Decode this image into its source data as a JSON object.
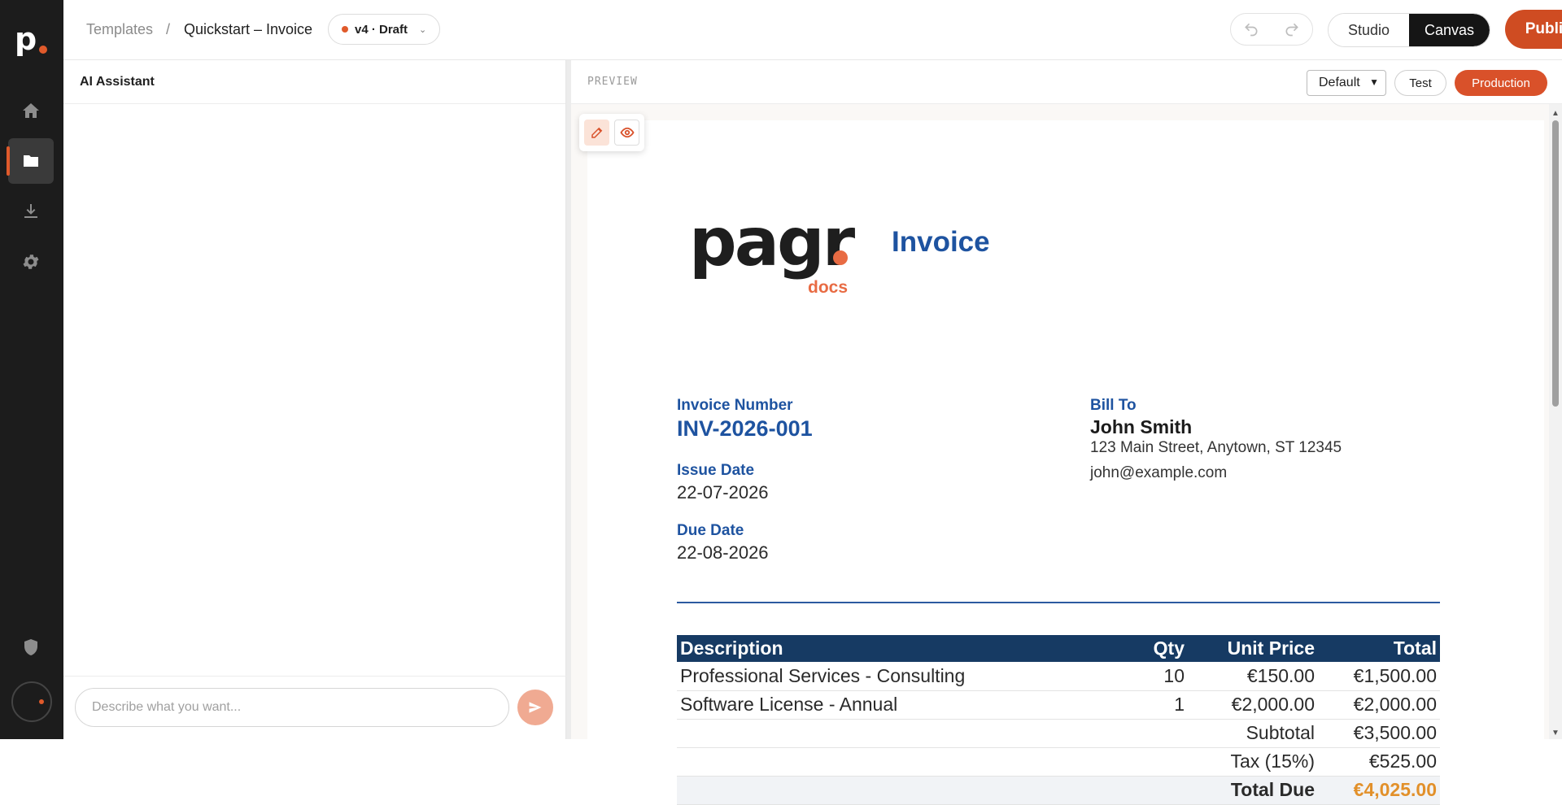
{
  "sidebar": {
    "logo": "p"
  },
  "header": {
    "breadcrumb_root": "Templates",
    "breadcrumb_sep": "/",
    "breadcrumb_current": "Quickstart – Invoice",
    "version": "v4 · Draft",
    "mode_studio": "Studio",
    "mode_canvas": "Canvas",
    "publish_label": "Publish"
  },
  "ai": {
    "title": "AI Assistant",
    "placeholder": "Describe what you want..."
  },
  "preview": {
    "label": "PREVIEW",
    "theme": "Default",
    "env_test": "Test",
    "env_production": "Production"
  },
  "invoice": {
    "logo_word": "pagr",
    "logo_sub": "docs",
    "title": "Invoice",
    "number_label": "Invoice Number",
    "number": "INV-2026-001",
    "issue_label": "Issue Date",
    "issue_date": "22-07-2026",
    "due_label": "Due Date",
    "due_date": "22-08-2026",
    "bill_label": "Bill To",
    "bill_name": "John Smith",
    "bill_address": "123 Main Street, Anytown, ST 12345",
    "bill_email": "john@example.com",
    "columns": [
      "Description",
      "Qty",
      "Unit Price",
      "Total"
    ],
    "rows": [
      [
        "Professional Services - Consulting",
        "10",
        "€150.00",
        "€1,500.00"
      ],
      [
        "Software License - Annual",
        "1",
        "€2,000.00",
        "€2,000.00"
      ]
    ],
    "subtotal_label": "Subtotal",
    "subtotal": "€3,500.00",
    "tax_label": "Tax (15%)",
    "tax": "€525.00",
    "total_label": "Total Due",
    "total": "€4,025.00"
  },
  "colors": {
    "accent": "#e05a2b",
    "navy": "#163a63",
    "blue": "#1e53a0"
  }
}
